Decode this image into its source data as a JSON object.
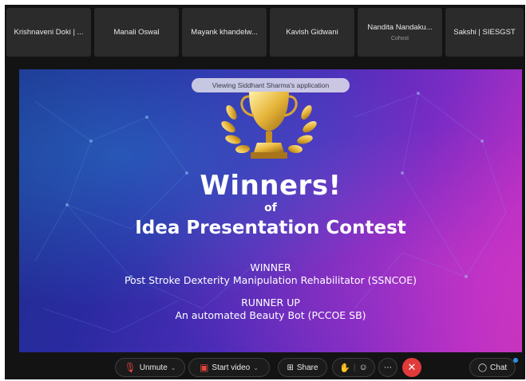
{
  "participants": [
    {
      "name": "Krishnaveni Doki | ...",
      "subtitle": ""
    },
    {
      "name": "Manali Oswal",
      "subtitle": ""
    },
    {
      "name": "Mayank khandelw...",
      "subtitle": ""
    },
    {
      "name": "Kavish Gidwani",
      "subtitle": ""
    },
    {
      "name": "Nandita Nandaku...",
      "subtitle": "Cohost"
    },
    {
      "name": "Sakshi | SIESGST",
      "subtitle": ""
    }
  ],
  "share_banner": "Viewing Siddhant Sharma's application",
  "slide": {
    "heading": "Winners!",
    "of": "of",
    "contest": "Idea Presentation Contest",
    "winner_label": "WINNER",
    "winner_entry": "Post Stroke Dexterity Manipulation Rehabilitator (SSNCOE)",
    "runner_label": "RUNNER UP",
    "runner_entry": "An automated Beauty Bot (PCCOE SB)"
  },
  "controls": {
    "unmute": "Unmute",
    "start_video": "Start video",
    "share": "Share",
    "chat": "Chat"
  },
  "colors": {
    "end_call": "#e13a3a",
    "muted_icon": "#e0453e",
    "chat_badge": "#2f8fe8"
  },
  "icons": [
    "mic-muted-icon",
    "video-off-icon",
    "share-icon",
    "raise-hand-icon",
    "reactions-icon",
    "more-icon",
    "end-call-icon",
    "chat-icon"
  ]
}
